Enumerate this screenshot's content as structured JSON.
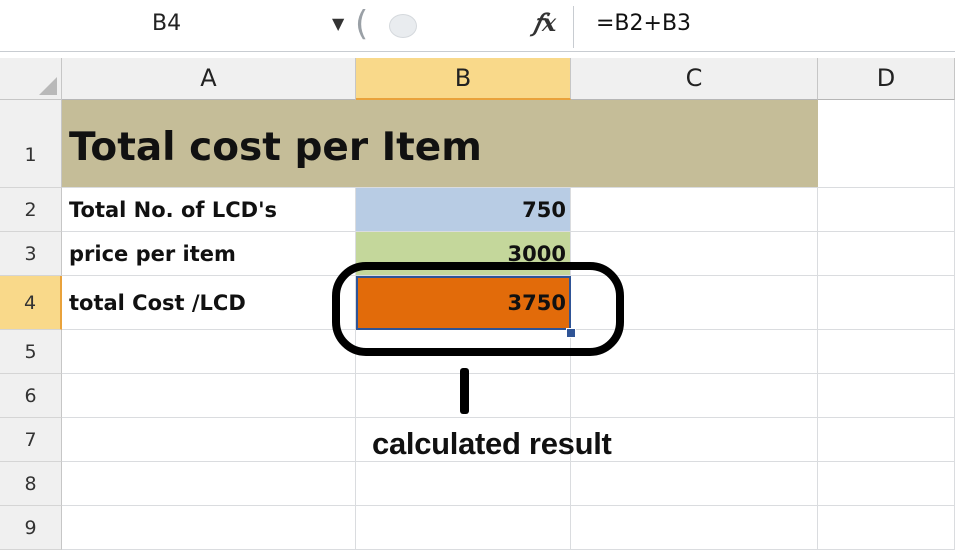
{
  "formula_bar": {
    "name_box": "B4",
    "fx_label": "fx",
    "formula": "=B2+B3"
  },
  "columns": [
    "A",
    "B",
    "C",
    "D"
  ],
  "rows": [
    "1",
    "2",
    "3",
    "4",
    "5",
    "6",
    "7",
    "8",
    "9"
  ],
  "cells": {
    "A1": "Total cost per Item",
    "A2": "Total No. of LCD's",
    "B2": "750",
    "A3": "price per item",
    "B3": "3000",
    "A4": "total Cost /LCD",
    "B4": "3750"
  },
  "colors": {
    "title_fill": "#c5bd98",
    "b2_fill": "#b8cce4",
    "b3_fill": "#c4d79b",
    "b4_fill": "#e26b0a",
    "selected_header": "#f9d98a"
  },
  "annotation": {
    "label": "calculated result"
  }
}
